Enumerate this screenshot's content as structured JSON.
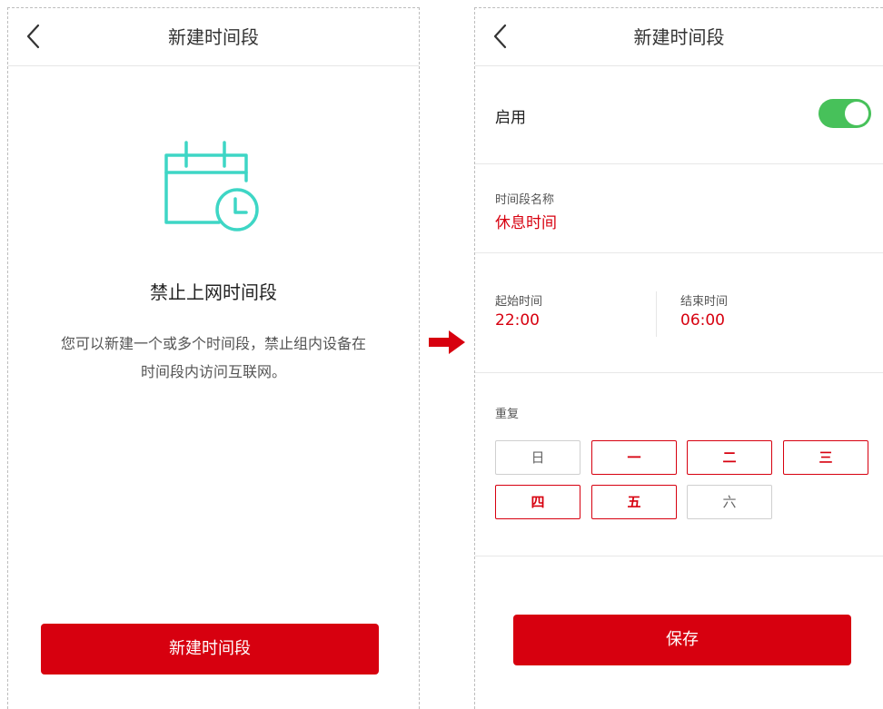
{
  "left_screen": {
    "header": {
      "title": "新建时间段"
    },
    "empty_state": {
      "title": "禁止上网时间段",
      "description_line1": "您可以新建一个或多个时间段，禁止组内设备在",
      "description_line2": "时间段内访问互联网。"
    },
    "new_button_label": "新建时间段"
  },
  "right_screen": {
    "header": {
      "title": "新建时间段"
    },
    "enable": {
      "label": "启用",
      "on": true
    },
    "name": {
      "label": "时间段名称",
      "value": "休息时间"
    },
    "start": {
      "label": "起始时间",
      "value": "22:00"
    },
    "end": {
      "label": "结束时间",
      "value": "06:00"
    },
    "repeat": {
      "label": "重复",
      "days": [
        {
          "label": "日",
          "selected": false
        },
        {
          "label": "一",
          "selected": true
        },
        {
          "label": "二",
          "selected": true
        },
        {
          "label": "三",
          "selected": true
        },
        {
          "label": "四",
          "selected": true
        },
        {
          "label": "五",
          "selected": true
        },
        {
          "label": "六",
          "selected": false
        }
      ]
    },
    "save_button_label": "保存"
  },
  "icons": {
    "back": "chevron-left-icon",
    "calendar": "calendar-clock-icon",
    "flow": "arrow-right-icon"
  },
  "colors": {
    "brand_red": "#d7000f",
    "toggle_green": "#47c15a",
    "icon_teal": "#3ed6c5"
  }
}
